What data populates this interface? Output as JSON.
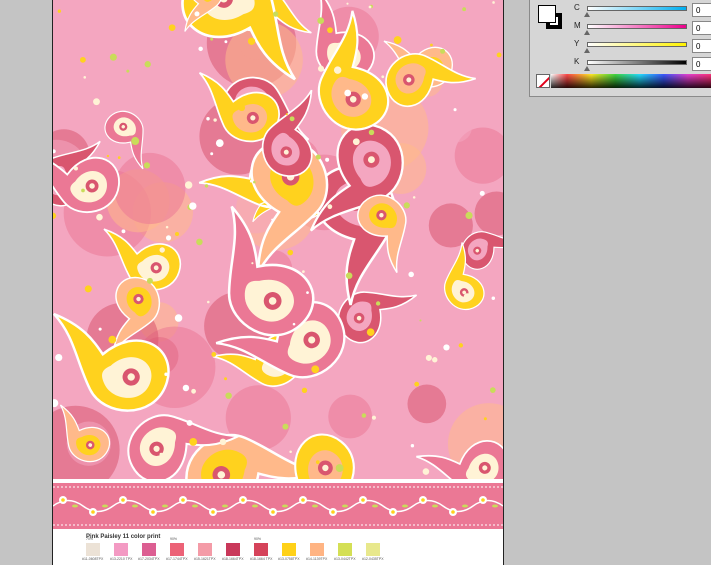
{
  "document": {
    "swatch_title": "Pink Paisley 11 color print",
    "swatches": [
      {
        "color": "#ece2d6",
        "code": "#11-0608TPX",
        "tag": "70%"
      },
      {
        "color": "#f39ac3",
        "code": "#13-2210 TPX",
        "tag": ""
      },
      {
        "color": "#dc5e92",
        "code": "#17-2034TPX",
        "tag": ""
      },
      {
        "color": "#ec6277",
        "code": "#17-1744TPX",
        "tag": "90%"
      },
      {
        "color": "#f49ba7",
        "code": "#15-1621TPX",
        "tag": ""
      },
      {
        "color": "#c9385a",
        "code": "#18-1664TPX",
        "tag": ""
      },
      {
        "color": "#d5435a",
        "code": "#18-1664 TPX",
        "tag": "90%"
      },
      {
        "color": "#ffd118",
        "code": "#13-0758TPX",
        "tag": ""
      },
      {
        "color": "#ffb483",
        "code": "#14-1139TPX",
        "tag": ""
      },
      {
        "color": "#d4df55",
        "code": "#13-0442TPX",
        "tag": ""
      },
      {
        "color": "#e8e88c",
        "code": "#12-0435TPX",
        "tag": ""
      }
    ]
  },
  "color_panel": {
    "channels": [
      {
        "label": "C",
        "value": "0",
        "gradient": [
          "#ffffff",
          "#00aeef"
        ]
      },
      {
        "label": "M",
        "value": "0",
        "gradient": [
          "#ffffff",
          "#ec008c"
        ]
      },
      {
        "label": "Y",
        "value": "0",
        "gradient": [
          "#ffffff",
          "#fff200"
        ]
      },
      {
        "label": "K",
        "value": "0",
        "gradient": [
          "#ffffff",
          "#000000"
        ]
      }
    ]
  },
  "palette": {
    "pink_light": "#f4a6c0",
    "pink_mid": "#eb7895",
    "pink_deep": "#d9566f",
    "yellow": "#ffd21e",
    "peach": "#ffb98a",
    "lime": "#c9dc5a",
    "cream": "#fff3d6"
  }
}
